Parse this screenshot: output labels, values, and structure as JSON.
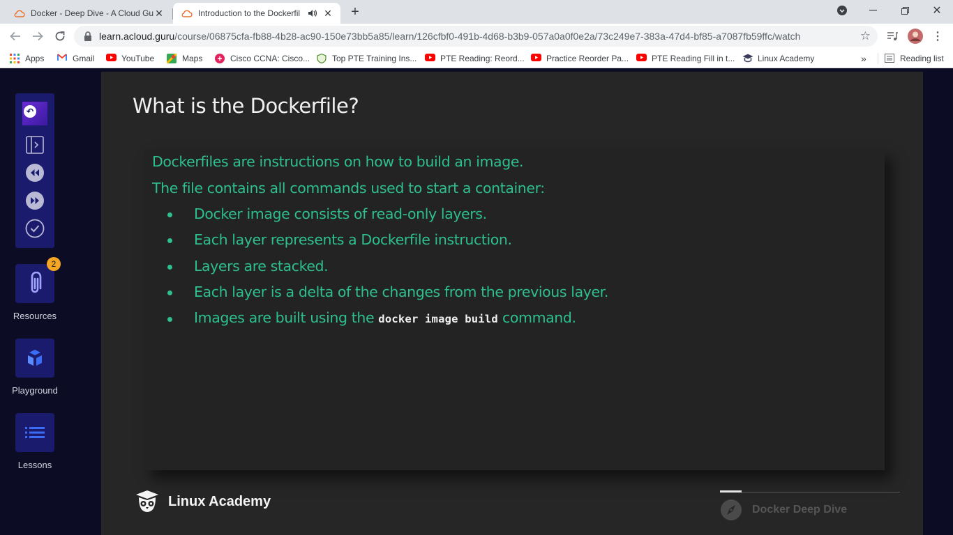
{
  "browser": {
    "tabs": [
      {
        "title": "Docker - Deep Dive - A Cloud Gu",
        "active": false
      },
      {
        "title": "Introduction to the Dockerfil",
        "active": true,
        "audio": true
      }
    ],
    "url_host": "learn.acloud.guru",
    "url_path": "/course/06875cfa-fb88-4b28-ac90-150e73bb5a85/learn/126cfbf0-491b-4d68-b3b9-057a0a0f0e2a/73c249e7-383a-47d4-bf85-a7087fb59ffc/watch",
    "bookmarks": [
      {
        "label": "Apps",
        "icon": "apps-grid-icon"
      },
      {
        "label": "Gmail",
        "icon": "gmail-icon"
      },
      {
        "label": "YouTube",
        "icon": "youtube-icon"
      },
      {
        "label": "Maps",
        "icon": "maps-icon"
      },
      {
        "label": "Cisco CCNA: Cisco...",
        "icon": "cisco-icon"
      },
      {
        "label": "Top PTE Training Ins...",
        "icon": "shield-icon"
      },
      {
        "label": "PTE Reading: Reord...",
        "icon": "youtube-icon"
      },
      {
        "label": "Practice Reorder Pa...",
        "icon": "youtube-icon"
      },
      {
        "label": "PTE Reading Fill in t...",
        "icon": "youtube-icon"
      },
      {
        "label": "Linux Academy",
        "icon": "linux-academy-icon"
      }
    ],
    "more_bookmarks": "»",
    "reading_list": "Reading list"
  },
  "sidebar": {
    "resources_label": "Resources",
    "resources_badge": "2",
    "playground_label": "Playground",
    "lessons_label": "Lessons"
  },
  "slide": {
    "title": "What is the Dockerfile?",
    "intro_lines": [
      "Dockerfiles are instructions on how to build an image.",
      "The file contains all commands used to start a container:"
    ],
    "bullets": [
      "Docker image consists of read-only layers.",
      "Each layer represents a Dockerfile instruction.",
      "Layers are stacked.",
      "Each layer is a delta of the changes from the previous layer."
    ],
    "last_bullet_prefix": "Images are built using the",
    "last_bullet_code": "docker image build",
    "last_bullet_suffix": "command.",
    "brand": "Linux Academy",
    "course": "Docker Deep Dive"
  },
  "colors": {
    "slide_text": "#2ebf8f",
    "sidebar_tile": "#1b1b6e",
    "badge": "#f5a623"
  }
}
